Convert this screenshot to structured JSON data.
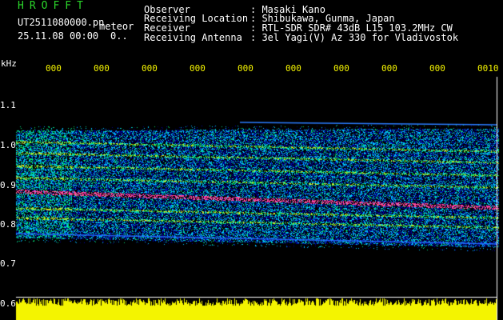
{
  "app_title": "HROFFT",
  "file_name": "UT2511080000.pn",
  "file_tag": "meteor",
  "timestamp": "25.11.08 00:00",
  "timestamp_suffix": "0..",
  "station": {
    "labels": [
      "Observer",
      "Receiving Location",
      "Receiver",
      "Receiving Antenna"
    ],
    "values": [
      ": Masaki Kano",
      ": Shibukawa, Gunma, Japan",
      ": RTL-SDR SDR# 43dB L15 103.2MHz CW",
      ": 3el Yagi(V) Az 330 for Vladivostok"
    ]
  },
  "axis": {
    "unit": "kHz",
    "y_ticks": [
      "1.1",
      "1.0",
      "0.9",
      "0.8",
      "0.7",
      "0.6"
    ],
    "time_ticks": [
      "000",
      "000",
      "000",
      "000",
      "000",
      "000",
      "000",
      "000",
      "000",
      "0010"
    ]
  },
  "colors": {
    "background": "#000000",
    "header_text": "#ffffff",
    "title": "#2bd62b",
    "time_ticks": "#f4f400",
    "amplitude": "#f4f400",
    "baseline": "#ffffff"
  }
}
